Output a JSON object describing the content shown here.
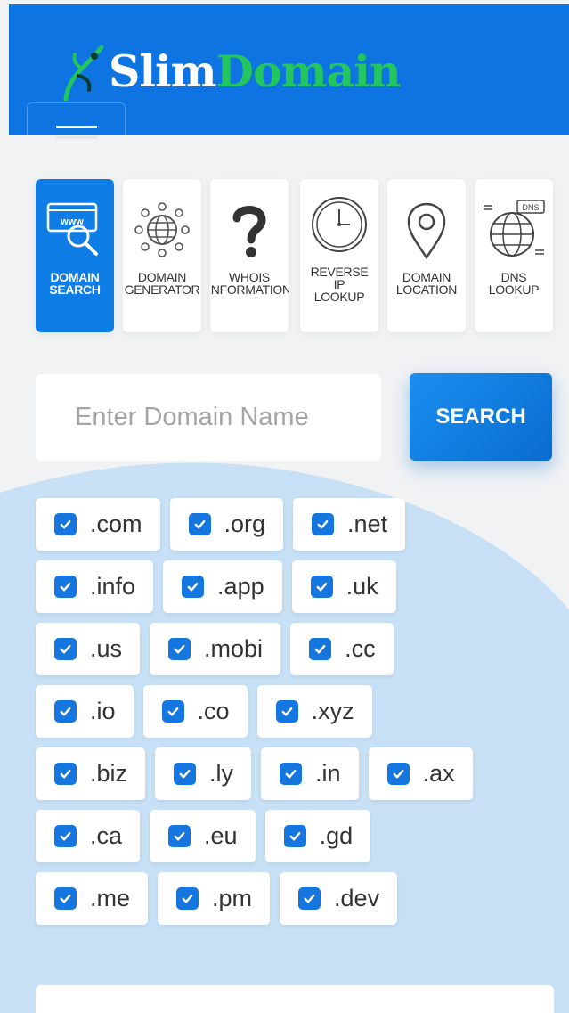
{
  "colors": {
    "primary": "#0d74e1",
    "brand_green": "#22c55e",
    "check": "#1476de",
    "wave": "#c7e0f5"
  },
  "header": {
    "logo_part1": "Slim",
    "logo_part2": "Domain",
    "logo_icon": "runner-icon",
    "menu_icon": "hamburger-icon"
  },
  "tools": [
    {
      "label": "DOMAIN\nSEARCH",
      "icon": "www-search-icon",
      "active": true
    },
    {
      "label": "DOMAIN\nGENERATOR",
      "icon": "globe-network-icon",
      "active": false
    },
    {
      "label": "WHOIS\nINFORMATION",
      "icon": "question-mark-icon",
      "active": false
    },
    {
      "label": "REVERSE\nIP\nLOOKUP",
      "icon": "clock-icon",
      "active": false
    },
    {
      "label": "DOMAIN\nLOCATION",
      "icon": "map-pin-icon",
      "active": false
    },
    {
      "label": "DNS\nLOOKUP",
      "icon": "dns-globe-icon",
      "active": false
    }
  ],
  "search": {
    "placeholder": "Enter Domain Name",
    "value": "",
    "button_label": "SEARCH"
  },
  "tlds": [
    [
      ".com",
      ".org",
      ".net"
    ],
    [
      ".info",
      ".app",
      ".uk"
    ],
    [
      ".us",
      ".mobi",
      ".cc"
    ],
    [
      ".io",
      ".co",
      ".xyz"
    ],
    [
      ".biz",
      ".ly",
      ".in",
      ".ax"
    ],
    [
      ".ca",
      ".eu",
      ".gd"
    ],
    [
      ".me",
      ".pm",
      ".dev"
    ]
  ]
}
